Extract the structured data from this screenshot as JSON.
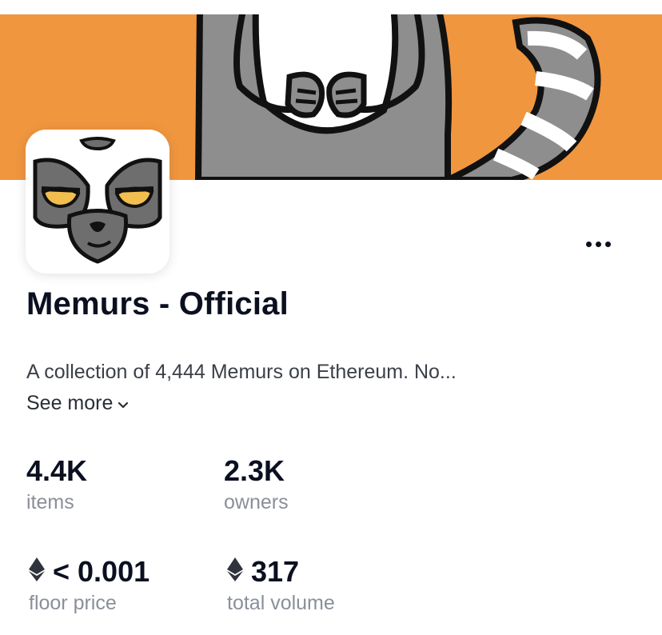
{
  "collection": {
    "name": "Memurs - Official",
    "description": "A collection of 4,444 Memurs on Ethereum. No...",
    "see_more_label": "See more"
  },
  "stats": {
    "items": {
      "value": "4.4K",
      "label": "items"
    },
    "owners": {
      "value": "2.3K",
      "label": "owners"
    },
    "floor_price": {
      "value": "< 0.001",
      "label": "floor price",
      "icon": "ethereum-icon"
    },
    "total_volume": {
      "value": "317",
      "label": "total volume",
      "icon": "ethereum-icon"
    }
  },
  "icons": {
    "more": "more-options-icon",
    "chevron": "chevron-down-icon"
  },
  "colors": {
    "banner_bg": "#F0963F",
    "lemur_gray": "#8E8E8E",
    "lemur_dark": "#4A4A4A",
    "eye_yellow": "#F2BE4E",
    "text_primary": "#0B1020",
    "text_secondary": "#8A8F99"
  }
}
